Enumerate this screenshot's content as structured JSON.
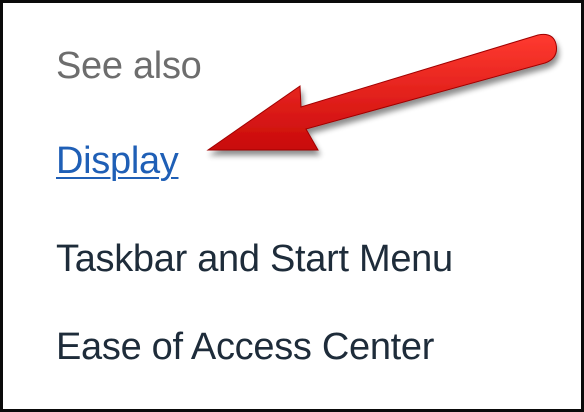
{
  "see_also": {
    "heading": "See also",
    "links": [
      {
        "label": "Display"
      },
      {
        "label": "Taskbar and Start Menu"
      },
      {
        "label": "Ease of Access Center"
      }
    ]
  },
  "annotation": {
    "icon": "red-arrow-icon",
    "color": "#e01010",
    "points_to": "Display"
  }
}
